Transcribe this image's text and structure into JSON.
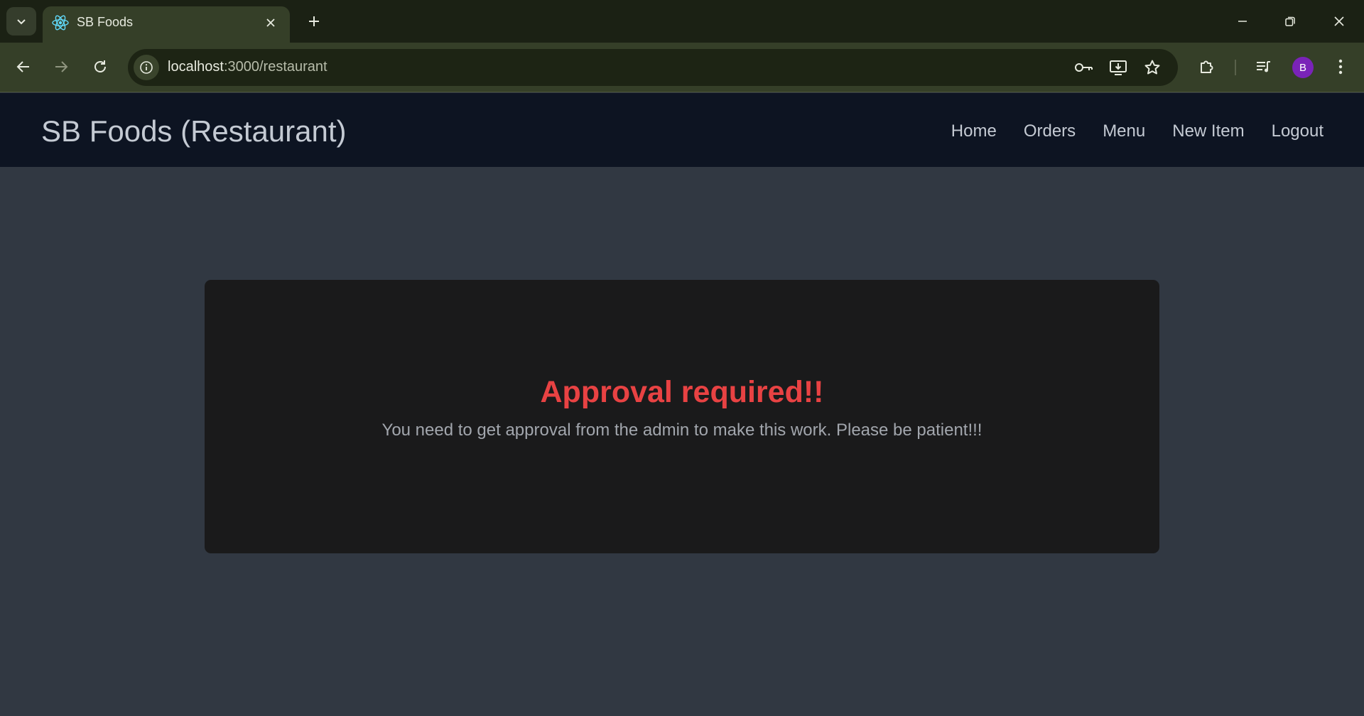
{
  "browser": {
    "tab": {
      "title": "SB Foods",
      "favicon": "react-icon"
    },
    "url": {
      "host": "localhost",
      "rest": ":3000/restaurant"
    },
    "profile_initial": "B",
    "colors": {
      "frame": "#1b2114",
      "toolbar": "#353f28",
      "avatar": "#7a23b8"
    }
  },
  "navbar": {
    "brand": "SB Foods (Restaurant)",
    "links": [
      {
        "label": "Home"
      },
      {
        "label": "Orders"
      },
      {
        "label": "Menu"
      },
      {
        "label": "New Item"
      },
      {
        "label": "Logout"
      }
    ]
  },
  "notice": {
    "title": "Approval required!!",
    "message": "You need to get approval from the admin to make this work. Please be patient!!!",
    "title_color": "#e84243"
  },
  "colors": {
    "navbar": "#0d1422",
    "page": "#313842",
    "card": "#1a1a1b"
  }
}
